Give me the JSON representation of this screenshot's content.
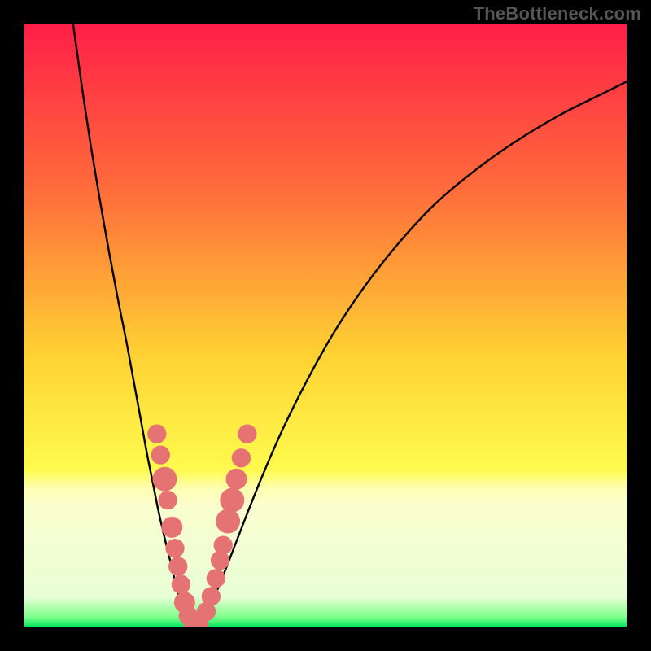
{
  "watermark": "TheBottleneck.com",
  "chart_data": {
    "type": "line",
    "title": "",
    "xlabel": "",
    "ylabel": "",
    "xlim": [
      0,
      100
    ],
    "ylim": [
      0,
      100
    ],
    "gradient_stops": [
      {
        "offset": 0.0,
        "color": "#ff1f47"
      },
      {
        "offset": 0.28,
        "color": "#ff6e3b"
      },
      {
        "offset": 0.55,
        "color": "#ffd233"
      },
      {
        "offset": 0.74,
        "color": "#fffb4e"
      },
      {
        "offset": 0.77,
        "color": "#fffeb0"
      },
      {
        "offset": 0.8,
        "color": "#fafecf"
      },
      {
        "offset": 0.95,
        "color": "#e9ffd6"
      },
      {
        "offset": 0.985,
        "color": "#7cff89"
      },
      {
        "offset": 1.0,
        "color": "#00e65e"
      }
    ],
    "series": [
      {
        "name": "bottleneck-curve",
        "x": [
          8.1,
          9.5,
          11.0,
          12.5,
          14.0,
          15.5,
          17.0,
          18.2,
          19.3,
          20.3,
          21.3,
          22.2,
          23.1,
          24.0,
          24.8,
          25.5,
          26.2,
          27.0,
          28.0,
          29.2,
          30.5,
          32.0,
          34.0,
          36.5,
          39.5,
          43.0,
          47.0,
          51.5,
          56.5,
          62.0,
          68.0,
          74.5,
          81.5,
          89.0,
          97.0,
          100.0
        ],
        "y": [
          100.0,
          90.0,
          80.0,
          71.0,
          62.5,
          54.5,
          47.0,
          40.5,
          34.5,
          29.0,
          24.0,
          19.5,
          15.5,
          11.8,
          8.5,
          5.5,
          3.0,
          1.0,
          0.0,
          0.5,
          2.5,
          6.0,
          11.0,
          17.5,
          25.0,
          33.0,
          41.0,
          49.0,
          56.5,
          63.5,
          70.0,
          75.5,
          80.5,
          85.0,
          89.0,
          90.5
        ]
      }
    ],
    "markers": {
      "name": "highlighted-points",
      "color": "#e57373",
      "points": [
        {
          "x": 22.0,
          "y": 32.0,
          "r": 1.0
        },
        {
          "x": 22.6,
          "y": 28.5,
          "r": 1.0
        },
        {
          "x": 23.3,
          "y": 24.5,
          "r": 1.5
        },
        {
          "x": 23.8,
          "y": 21.0,
          "r": 1.0
        },
        {
          "x": 24.5,
          "y": 16.5,
          "r": 1.2
        },
        {
          "x": 25.0,
          "y": 13.0,
          "r": 1.0
        },
        {
          "x": 25.5,
          "y": 10.0,
          "r": 1.0
        },
        {
          "x": 26.0,
          "y": 7.0,
          "r": 1.0
        },
        {
          "x": 26.6,
          "y": 4.0,
          "r": 1.2
        },
        {
          "x": 27.2,
          "y": 1.8,
          "r": 1.0
        },
        {
          "x": 28.0,
          "y": 0.3,
          "r": 1.0
        },
        {
          "x": 29.0,
          "y": 0.5,
          "r": 1.0
        },
        {
          "x": 30.2,
          "y": 2.5,
          "r": 1.0
        },
        {
          "x": 31.0,
          "y": 5.0,
          "r": 1.0
        },
        {
          "x": 31.8,
          "y": 8.0,
          "r": 1.0
        },
        {
          "x": 32.5,
          "y": 11.0,
          "r": 1.0
        },
        {
          "x": 33.0,
          "y": 13.5,
          "r": 1.0
        },
        {
          "x": 33.8,
          "y": 17.5,
          "r": 1.5
        },
        {
          "x": 34.5,
          "y": 21.0,
          "r": 1.5
        },
        {
          "x": 35.2,
          "y": 24.5,
          "r": 1.2
        },
        {
          "x": 36.0,
          "y": 28.0,
          "r": 1.0
        },
        {
          "x": 37.0,
          "y": 32.0,
          "r": 1.0
        }
      ]
    }
  }
}
